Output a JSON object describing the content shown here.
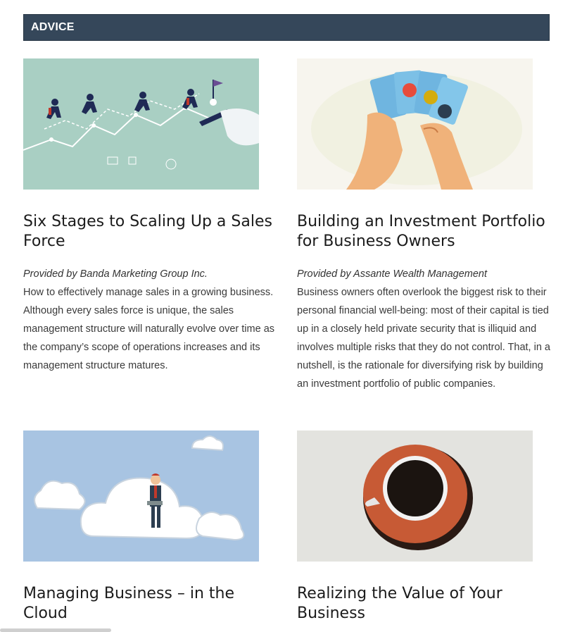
{
  "section": {
    "title": "ADVICE",
    "bar_color": "#35475a"
  },
  "articles": [
    {
      "title": "Six Stages to Scaling Up a Sales Force",
      "provider": "Provided by Banda Marketing Group Inc.",
      "description": "How to effectively manage sales in a growing business. Although every sales force is unique, the sales management structure will naturally evolve over time as the company’s scope of operations increases and its management structure matures.",
      "image": "runners-growth-chart-illustration"
    },
    {
      "title": "Building an Investment Portfolio for Business Owners",
      "provider": "Provided by Assante Wealth Management",
      "description": "Business owners often overlook the biggest risk to their personal financial well-being: most of their capital is tied up in a closely held private security that is illiquid and involves multiple risks that they do not control. That, in a nutshell, is the rationale for diversifying risk by building an investment portfolio of public companies.",
      "image": "hands-holding-cards-illustration"
    },
    {
      "title": "Managing Business – in the Cloud",
      "provider": "",
      "description": "",
      "image": "businessman-on-cloud-illustration"
    },
    {
      "title": "Realizing the Value of Your Business",
      "provider": "",
      "description": "",
      "image": "coffee-cup-illustration"
    }
  ]
}
